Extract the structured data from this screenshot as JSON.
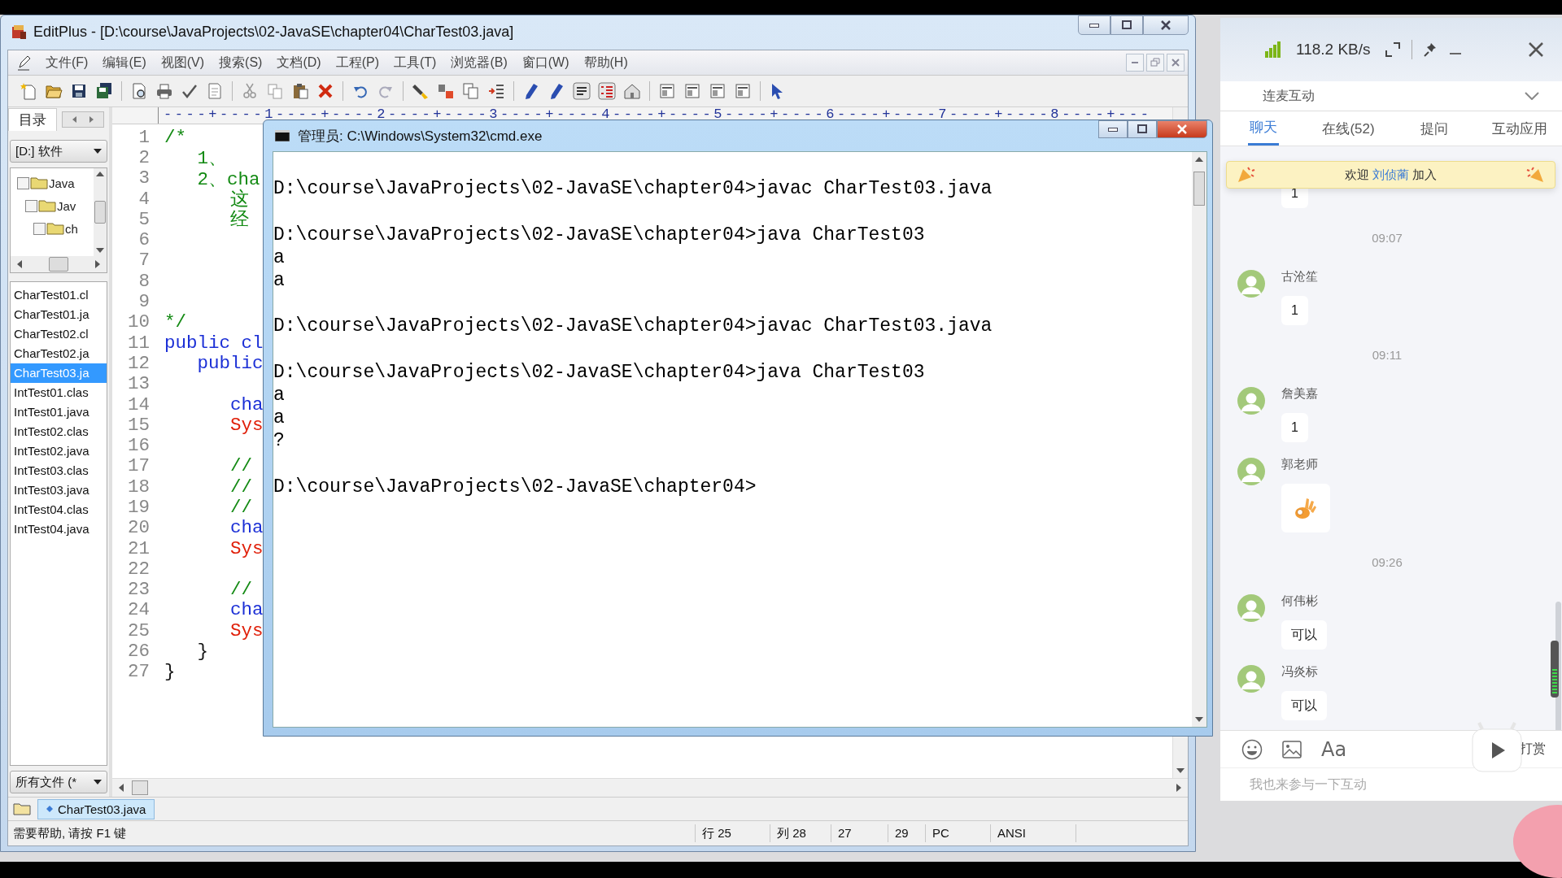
{
  "editplus": {
    "title": "EditPlus - [D:\\course\\JavaProjects\\02-JavaSE\\chapter04\\CharTest03.java]",
    "menu": [
      "文件(F)",
      "编辑(E)",
      "视图(V)",
      "搜索(S)",
      "文档(D)",
      "工程(P)",
      "工具(T)",
      "浏览器(B)",
      "窗口(W)",
      "帮助(H)"
    ],
    "sidebar": {
      "tab": "目录",
      "drive": "[D:] 软件",
      "tree": [
        {
          "label": "Java",
          "checked": false,
          "children": [
            {
              "label": "Jav",
              "checked": false,
              "children": [
                {
                  "label": "ch",
                  "checked": false
                }
              ]
            }
          ]
        }
      ],
      "files": [
        {
          "name": "CharTest01.cl",
          "selected": false
        },
        {
          "name": "CharTest01.ja",
          "selected": false
        },
        {
          "name": "CharTest02.cl",
          "selected": false
        },
        {
          "name": "CharTest02.ja",
          "selected": false
        },
        {
          "name": "CharTest03.ja",
          "selected": true
        },
        {
          "name": "IntTest01.clas",
          "selected": false
        },
        {
          "name": "IntTest01.java",
          "selected": false
        },
        {
          "name": "IntTest02.clas",
          "selected": false
        },
        {
          "name": "IntTest02.java",
          "selected": false
        },
        {
          "name": "IntTest03.clas",
          "selected": false
        },
        {
          "name": "IntTest03.java",
          "selected": false
        },
        {
          "name": "IntTest04.clas",
          "selected": false
        },
        {
          "name": "IntTest04.java",
          "selected": false
        }
      ],
      "filter": "所有文件 (*"
    },
    "ruler": "----+----1----+----2----+----3----+----4----+----5----+----6----+----7----+----8----+---",
    "code_lines": [
      {
        "number": "1",
        "text": "/*",
        "kind": "comment"
      },
      {
        "number": "2",
        "text": "   1、",
        "kind": "comment"
      },
      {
        "number": "3",
        "text": "   2、cha",
        "kind": "comment"
      },
      {
        "number": "4",
        "text": "      这",
        "kind": "comment"
      },
      {
        "number": "5",
        "text": "      经",
        "kind": "comment"
      },
      {
        "number": "6"
      },
      {
        "number": "7"
      },
      {
        "number": "8"
      },
      {
        "number": "9"
      },
      {
        "number": "10",
        "text": "*/",
        "kind": "comment"
      },
      {
        "number": "11",
        "text": "public cl",
        "kind": "keyword"
      },
      {
        "number": "12",
        "text": "   public",
        "kind": "keyword"
      },
      {
        "number": "13"
      },
      {
        "number": "14",
        "text": "      cha",
        "kind": "keyword"
      },
      {
        "number": "15",
        "text": "      Sys",
        "kind": "call"
      },
      {
        "number": "16"
      },
      {
        "number": "17",
        "text": "      //",
        "kind": "comment"
      },
      {
        "number": "18",
        "text": "      //",
        "kind": "comment"
      },
      {
        "number": "19",
        "text": "      //",
        "kind": "comment"
      },
      {
        "number": "20",
        "text": "      cha",
        "kind": "keyword"
      },
      {
        "number": "21",
        "text": "      Sys",
        "kind": "call"
      },
      {
        "number": "22"
      },
      {
        "number": "23",
        "text": "      //",
        "kind": "comment"
      },
      {
        "number": "24",
        "text": "      cha",
        "kind": "keyword"
      },
      {
        "number": "25",
        "text": "      Sys",
        "kind": "call"
      },
      {
        "number": "26",
        "text": "   }",
        "kind": "plain"
      },
      {
        "number": "27",
        "text": "}",
        "kind": "plain"
      }
    ],
    "document_tabs": [
      {
        "label": "CharTest03.java",
        "selected": true
      }
    ],
    "status_bar": {
      "help": "需要帮助, 请按 F1 键",
      "fields": [
        "行 25",
        "列 28",
        "27",
        "29",
        "PC",
        "ANSI"
      ]
    }
  },
  "cmd": {
    "title": "管理员: C:\\Windows\\System32\\cmd.exe",
    "blocks": [
      {
        "prompt": "D:\\course\\JavaProjects\\02-JavaSE\\chapter04>javac CharTest03.java"
      },
      {
        "prompt": "D:\\course\\JavaProjects\\02-JavaSE\\chapter04>java CharTest03",
        "output": [
          "a",
          "a"
        ]
      },
      {
        "prompt": "D:\\course\\JavaProjects\\02-JavaSE\\chapter04>javac CharTest03.java"
      },
      {
        "prompt": "D:\\course\\JavaProjects\\02-JavaSE\\chapter04>java CharTest03",
        "output": [
          "a",
          "a",
          "?"
        ]
      },
      {
        "prompt": "D:\\course\\JavaProjects\\02-JavaSE\\chapter04>"
      }
    ]
  },
  "chat": {
    "speed": "118.2 KB/s",
    "section": "连麦互动",
    "tabs": [
      {
        "label": "聊天",
        "selected": true
      },
      {
        "label": "在线(52)",
        "selected": false
      },
      {
        "label": "提问",
        "selected": false
      },
      {
        "label": "互动应用",
        "selected": false
      }
    ],
    "welcome": {
      "prefix": "欢迎",
      "name": "刘侦蔺",
      "suffix": "加入"
    },
    "items": [
      {
        "kind": "message",
        "text": "1"
      },
      {
        "kind": "time",
        "text": "09:07"
      },
      {
        "kind": "message",
        "name": "古沧笙",
        "text": "1"
      },
      {
        "kind": "time",
        "text": "09:11"
      },
      {
        "kind": "message",
        "name": "詹美嘉",
        "text": "1"
      },
      {
        "kind": "sticker",
        "name": "郭老师"
      },
      {
        "kind": "time",
        "text": "09:26"
      },
      {
        "kind": "message",
        "name": "何伟彬",
        "text": "可以"
      },
      {
        "kind": "message",
        "name": "冯炎标",
        "text": "可以"
      }
    ],
    "font_button": "Aa",
    "reward": "打赏",
    "input": {
      "placeholder": "我也来参与一下互动"
    }
  }
}
